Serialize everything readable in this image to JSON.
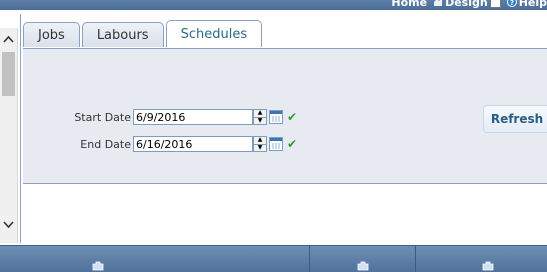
{
  "top_menu": {
    "home": "Home",
    "design": "Design",
    "help": "Help"
  },
  "tabs": [
    {
      "label": "Jobs",
      "active": false
    },
    {
      "label": "Labours",
      "active": false
    },
    {
      "label": "Schedules",
      "active": true
    }
  ],
  "form": {
    "start_date_label": "Start Date",
    "start_date_value": "6/9/2016",
    "end_date_label": "End Date",
    "end_date_value": "6/16/2016"
  },
  "actions": {
    "refresh_label": "Refresh"
  },
  "icons": {
    "design": "design-icon",
    "help": "help-icon",
    "calendar": "calendar-icon",
    "valid": "checkmark-icon",
    "bottom": "puzzle-icon"
  },
  "colors": {
    "header_bar": "#4a6d98",
    "panel_bg": "#e7ebf1",
    "active_tab_text": "#2a6b85",
    "check": "#2e9b2e"
  }
}
